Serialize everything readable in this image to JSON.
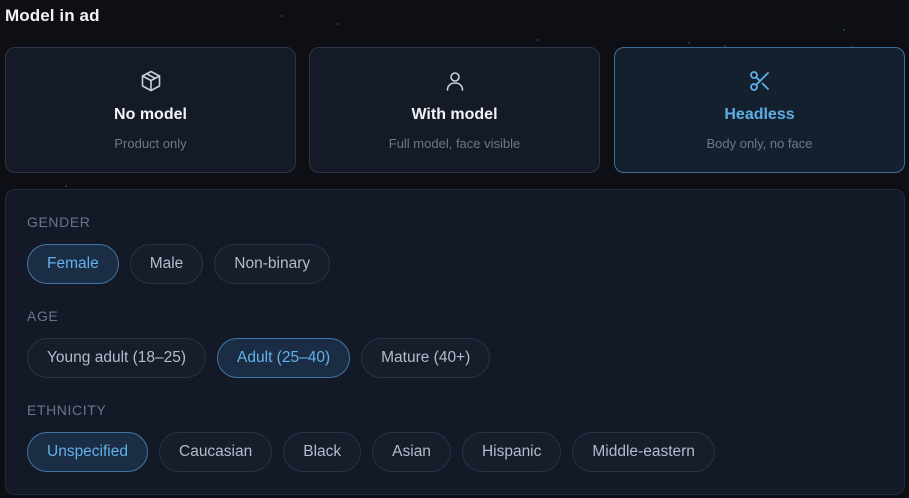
{
  "section": {
    "title": "Model in ad"
  },
  "model_options": [
    {
      "icon": "box-icon",
      "title": "No model",
      "subtitle": "Product only",
      "selected": false
    },
    {
      "icon": "person-icon",
      "title": "With model",
      "subtitle": "Full model, face visible",
      "selected": false
    },
    {
      "icon": "scissors-icon",
      "title": "Headless",
      "subtitle": "Body only, no face",
      "selected": true
    }
  ],
  "filters": {
    "gender": {
      "label": "GENDER",
      "options": [
        "Female",
        "Male",
        "Non-binary"
      ],
      "selected": "Female"
    },
    "age": {
      "label": "AGE",
      "options": [
        "Young adult (18–25)",
        "Adult (25–40)",
        "Mature (40+)"
      ],
      "selected": "Adult (25–40)"
    },
    "ethnicity": {
      "label": "ETHNICITY",
      "options": [
        "Unspecified",
        "Caucasian",
        "Black",
        "Asian",
        "Hispanic",
        "Middle-eastern"
      ],
      "selected": "Unspecified"
    }
  },
  "colors": {
    "accent": "#5eaee6",
    "selected_border": "#3f77a6",
    "card_border": "#2a3446",
    "background": "#0d0f14"
  }
}
